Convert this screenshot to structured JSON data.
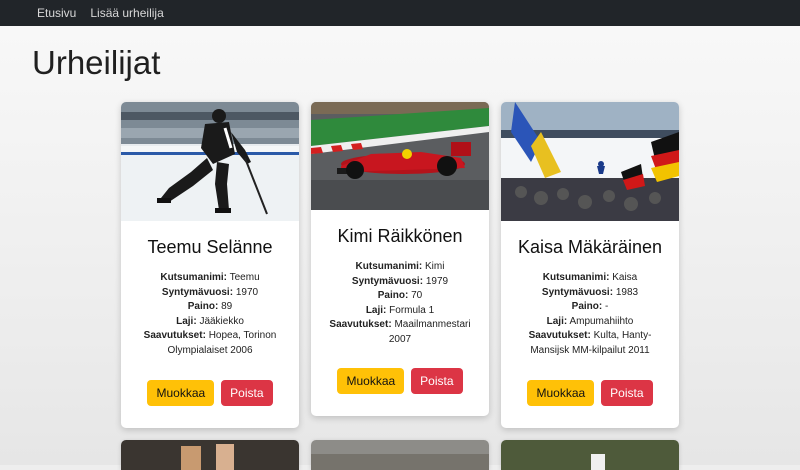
{
  "nav": {
    "home": "Etusivu",
    "add": "Lisää urheilija"
  },
  "page": {
    "title": "Urheilijat"
  },
  "labels": {
    "nickname": "Kutsumanimi:",
    "birth_year": "Syntymävuosi:",
    "weight": "Paino:",
    "sport": "Laji:",
    "achievements": "Saavutukset:"
  },
  "buttons": {
    "edit": "Muokkaa",
    "delete": "Poista"
  },
  "athletes": [
    {
      "name": "Teemu Selänne",
      "nickname": "Teemu",
      "birth_year": "1970",
      "weight": "89",
      "sport": "Jääkiekko",
      "achievements": "Hopea, Torinon Olympialaiset 2006"
    },
    {
      "name": "Kimi Räikkönen",
      "nickname": "Kimi",
      "birth_year": "1979",
      "weight": "70",
      "sport": "Formula 1",
      "achievements": "Maailmanmestari 2007"
    },
    {
      "name": "Kaisa Mäkäräinen",
      "nickname": "Kaisa",
      "birth_year": "1983",
      "weight": "-",
      "sport": "Ampumahiihto",
      "achievements": "Kulta, Hanty-Mansijsk MM-kilpailut 2011"
    }
  ]
}
